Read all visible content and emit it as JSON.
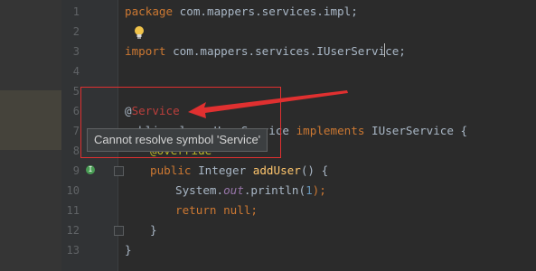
{
  "editor": {
    "line_numbers": [
      "1",
      "2",
      "3",
      "4",
      "5",
      "6",
      "7",
      "8",
      "9",
      "10",
      "11",
      "12",
      "13"
    ],
    "lines": {
      "l1": {
        "kw": "package",
        "rest": " com.mappers.services.impl;"
      },
      "l3": {
        "kw": "import",
        "rest": " com.mappers.services.IUserService;"
      },
      "l6": {
        "at": "@",
        "name": "Service"
      },
      "l7": {
        "a": "public class UserService",
        "kw": "implements",
        "rest": " IUserService {"
      },
      "l8": {
        "ann": "@Override"
      },
      "l9": {
        "kw": "public",
        "type": " Integer ",
        "fn": "addUser",
        "rest": "() {"
      },
      "l10": {
        "a": "System.",
        "fld": "out",
        "rest": ".println(",
        "num": "1",
        "end": ");"
      },
      "l11": {
        "kw": "return",
        "kw2": " null",
        "end": ";"
      },
      "l12": {
        "rest": "}"
      },
      "l13": {
        "rest": "}"
      }
    }
  },
  "tooltip": {
    "text": "Cannot resolve symbol 'Service'"
  },
  "colors": {
    "annotation_box": "#e03030",
    "arrow": "#e03030",
    "error_text": "#bc3f3c",
    "keyword": "#cc7832"
  },
  "icons": {
    "intention_bulb": "lightbulb-icon",
    "implements_marker": "implements-icon",
    "fold": "fold-icon"
  }
}
